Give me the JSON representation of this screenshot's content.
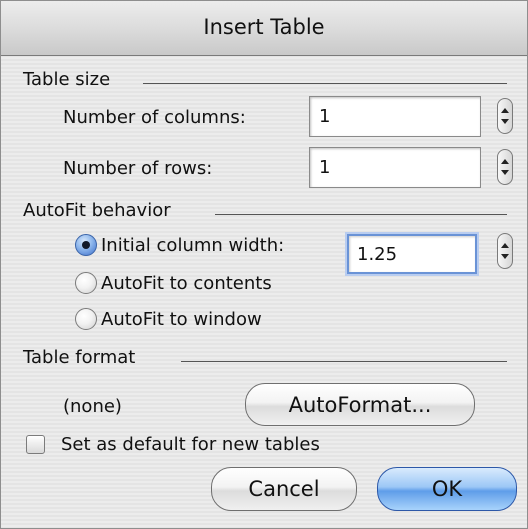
{
  "dialog": {
    "title": "Insert Table"
  },
  "table_size": {
    "heading": "Table size",
    "columns_label": "Number of columns:",
    "columns_value": "1",
    "rows_label": "Number of rows:",
    "rows_value": "1"
  },
  "autofit": {
    "heading": "AutoFit behavior",
    "options": [
      {
        "label": "Initial column width:",
        "selected": true
      },
      {
        "label": "AutoFit to contents",
        "selected": false
      },
      {
        "label": "AutoFit to window",
        "selected": false
      }
    ],
    "column_width_value": "1.25"
  },
  "table_format": {
    "heading": "Table format",
    "current": "(none)",
    "autoformat_button": "AutoFormat..."
  },
  "default_checkbox": {
    "label": "Set as default for new tables",
    "checked": false
  },
  "buttons": {
    "cancel": "Cancel",
    "ok": "OK"
  },
  "colors": {
    "accent_blue": "#5f9de9",
    "focus_ring": "#6a93d6"
  }
}
